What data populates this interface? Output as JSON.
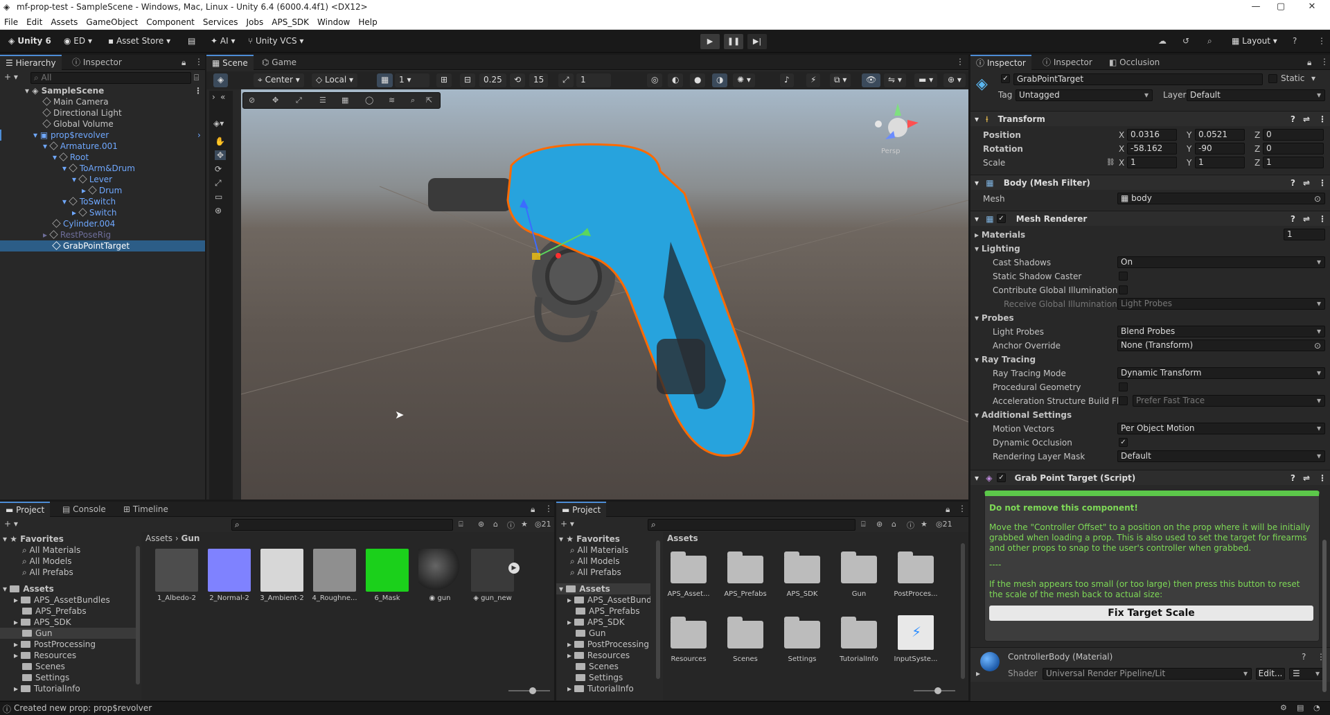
{
  "window": {
    "title": "mf-prop-test - SampleScene - Windows, Mac, Linux - Unity 6.4 (6000.4.4f1) <DX12>"
  },
  "menu": [
    "File",
    "Edit",
    "Assets",
    "GameObject",
    "Component",
    "Services",
    "Jobs",
    "APS_SDK",
    "Window",
    "Help"
  ],
  "toolbar": {
    "unity_version": "Unity 6",
    "account": "ED",
    "asset_store": "Asset Store",
    "ai": "AI",
    "vcs": "Unity VCS",
    "layout": "Layout"
  },
  "hierarchy": {
    "tabs": [
      "Hierarchy",
      "Inspector"
    ],
    "search_placeholder": "All",
    "items": [
      {
        "label": "SampleScene",
        "indent": 0
      },
      {
        "label": "Main Camera",
        "indent": 1
      },
      {
        "label": "Directional Light",
        "indent": 1
      },
      {
        "label": "Global Volume",
        "indent": 1
      },
      {
        "label": "prop$revolver",
        "indent": 1
      },
      {
        "label": "Armature.001",
        "indent": 2
      },
      {
        "label": "Root",
        "indent": 3
      },
      {
        "label": "ToArm&Drum",
        "indent": 4
      },
      {
        "label": "Lever",
        "indent": 5
      },
      {
        "label": "Drum",
        "indent": 6
      },
      {
        "label": "ToSwitch",
        "indent": 4
      },
      {
        "label": "Switch",
        "indent": 5
      },
      {
        "label": "Cylinder.004",
        "indent": 2
      },
      {
        "label": "RestPoseRig",
        "indent": 2
      },
      {
        "label": "GrabPointTarget",
        "indent": 2
      }
    ]
  },
  "scene": {
    "tabs": [
      "Scene",
      "Game"
    ],
    "pivot": "Center",
    "space": "Local",
    "grid_value": "1",
    "snap_value": "0.25",
    "rotate_snap": "15",
    "scale_snap": "1",
    "persp_label": "Persp"
  },
  "inspector": {
    "tabs": [
      "Inspector",
      "Inspector",
      "Occlusion"
    ],
    "object_name": "GrabPointTarget",
    "static_label": "Static",
    "tag_label": "Tag",
    "tag": "Untagged",
    "layer_label": "Layer",
    "layer": "Default",
    "transform": {
      "title": "Transform",
      "position_label": "Position",
      "position": {
        "x": "0.0316",
        "y": "0.0521",
        "z": "0"
      },
      "rotation_label": "Rotation",
      "rotation": {
        "x": "-58.162",
        "y": "-90",
        "z": "0"
      },
      "scale_label": "Scale",
      "scale": {
        "x": "1",
        "y": "1",
        "z": "1"
      }
    },
    "mesh_filter": {
      "title": "Body (Mesh Filter)",
      "mesh_label": "Mesh",
      "mesh": "body"
    },
    "mesh_renderer": {
      "title": "Mesh Renderer",
      "materials_label": "Materials",
      "materials_count": "1",
      "lighting_label": "Lighting",
      "cast_shadows_label": "Cast Shadows",
      "cast_shadows": "On",
      "static_shadow_label": "Static Shadow Caster",
      "contribute_gi_label": "Contribute Global Illumination",
      "receive_gi_label": "Receive Global Illumination",
      "receive_gi": "Light Probes",
      "probes_label": "Probes",
      "light_probes_label": "Light Probes",
      "light_probes": "Blend Probes",
      "anchor_label": "Anchor Override",
      "anchor": "None (Transform)",
      "ray_tracing_label": "Ray Tracing",
      "rt_mode_label": "Ray Tracing Mode",
      "rt_mode": "Dynamic Transform",
      "proc_geo_label": "Procedural Geometry",
      "accel_label": "Acceleration Structure Build Fla",
      "accel": "Prefer Fast Trace",
      "additional_label": "Additional Settings",
      "motion_label": "Motion Vectors",
      "motion": "Per Object Motion",
      "dyn_occ_label": "Dynamic Occlusion",
      "layer_mask_label": "Rendering Layer Mask",
      "layer_mask": "Default"
    },
    "script": {
      "title": "Grab Point Target (Script)",
      "warning_title": "Do not remove this component!",
      "text1": "Move the \"Controller Offset\" to a position on the prop where it will be initially grabbed when loading a prop. This is also used to set the target for firearms and other props to snap to the user's controller when grabbed.",
      "divider": "----",
      "text2": "If the mesh appears too small (or too large) then press this button to reset the scale of the mesh back to actual size:",
      "button": "Fix Target Scale"
    },
    "material": {
      "title": "ControllerBody (Material)",
      "shader_label": "Shader",
      "shader": "Universal Render Pipeline/Lit",
      "edit": "Edit..."
    }
  },
  "project_left": {
    "tabs": [
      "Project",
      "Console",
      "Timeline"
    ],
    "badge": "21",
    "favorites_label": "Favorites",
    "favorites": [
      "All Materials",
      "All Models",
      "All Prefabs"
    ],
    "assets_label": "Assets",
    "folders": [
      "APS_AssetBundles",
      "APS_Prefabs",
      "APS_SDK",
      "Gun",
      "PostProcessing",
      "Resources",
      "Scenes",
      "Settings",
      "TutorialInfo"
    ],
    "breadcrumb": [
      "Assets",
      "Gun"
    ],
    "items": [
      {
        "label": "1_Albedo-2",
        "color": "#555"
      },
      {
        "label": "2_Normal-2",
        "color": "#7b7bff"
      },
      {
        "label": "3_Ambient-2",
        "color": "#ddd"
      },
      {
        "label": "4_Roughne...",
        "color": "#999"
      },
      {
        "label": "6_Mask",
        "color": "#1fd11f"
      },
      {
        "label": "gun",
        "color": "#333"
      },
      {
        "label": "gun_new",
        "color": "#444"
      }
    ]
  },
  "project_right": {
    "tabs": [
      "Project"
    ],
    "badge": "21",
    "favorites_label": "Favorites",
    "favorites": [
      "All Materials",
      "All Models",
      "All Prefabs"
    ],
    "assets_label": "Assets",
    "folders": [
      "APS_AssetBund",
      "APS_Prefabs",
      "APS_SDK",
      "Gun",
      "PostProcessing",
      "Resources",
      "Scenes",
      "Settings",
      "TutorialInfo"
    ],
    "breadcrumb": "Assets",
    "items": [
      "APS_Asset...",
      "APS_Prefabs",
      "APS_SDK",
      "Gun",
      "PostProces...",
      "Resources",
      "Scenes",
      "Settings",
      "TutorialInfo",
      "InputSyste..."
    ]
  },
  "status": {
    "message": "Created new prop: prop$revolver"
  }
}
